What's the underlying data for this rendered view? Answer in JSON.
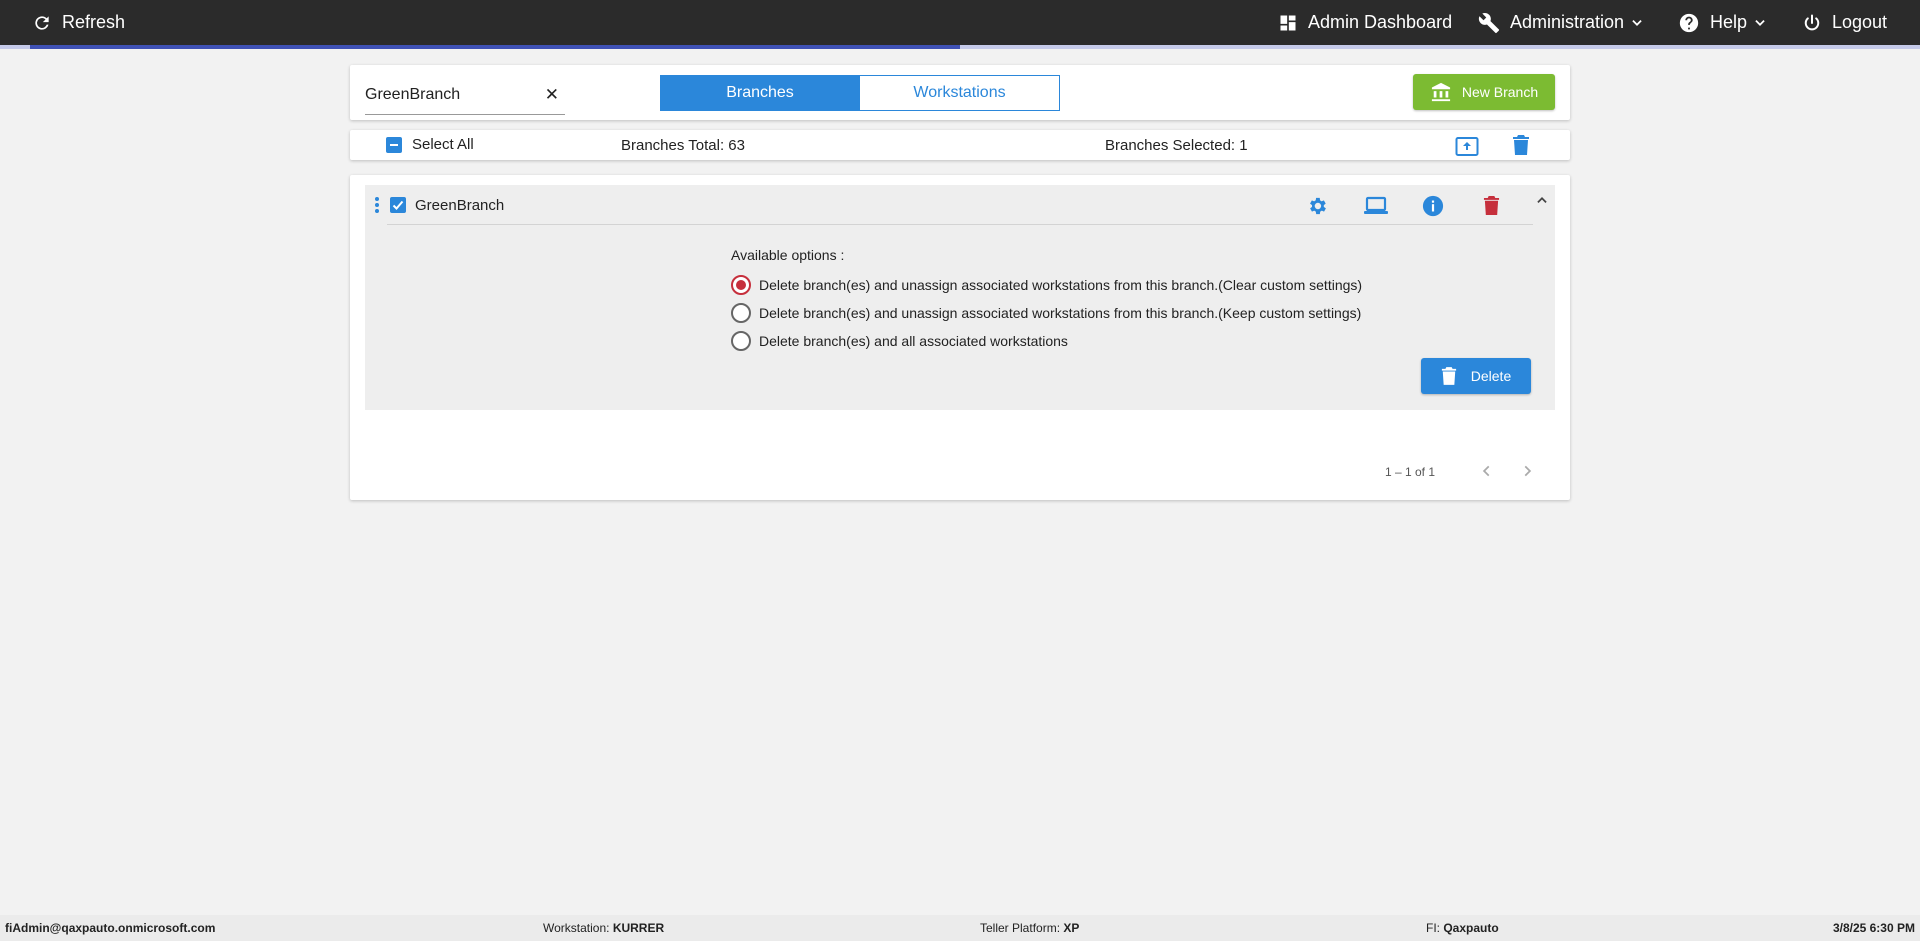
{
  "topbar": {
    "refresh_label": "Refresh",
    "admin_dashboard_label": "Admin Dashboard",
    "administration_label": "Administration",
    "help_label": "Help",
    "logout_label": "Logout",
    "load_progress": 0.5
  },
  "search": {
    "value": "GreenBranch"
  },
  "tabs": {
    "branches_label": "Branches",
    "workstations_label": "Workstations",
    "active": "Branches"
  },
  "new_branch_label": "New Branch",
  "summary": {
    "select_all_label": "Select All",
    "branches_total": "Branches Total: 63",
    "branches_selected": "Branches Selected: 1"
  },
  "branch": {
    "name": "GreenBranch",
    "checked": true
  },
  "delete_options": {
    "title": "Available options :",
    "items": [
      {
        "label": "Delete branch(es) and unassign associated workstations from this branch.(Clear custom settings)",
        "selected": true
      },
      {
        "label": "Delete branch(es) and unassign associated workstations from this branch.(Keep custom settings)",
        "selected": false
      },
      {
        "label": "Delete branch(es) and all associated workstations",
        "selected": false
      }
    ],
    "delete_label": "Delete"
  },
  "paginator": {
    "range_label": "1 – 1 of 1"
  },
  "footer": {
    "user": "fiAdmin@qaxpauto.onmicrosoft.com",
    "workstation_label": "Workstation:",
    "workstation_value": "KURRER",
    "teller_label": "Teller Platform:",
    "teller_value": "XP",
    "fi_label": "FI:",
    "fi_value": "Qaxpauto",
    "datetime": "3/8/25 6:30 PM"
  },
  "colors": {
    "accent": "#2b87da",
    "success": "#7cbb32",
    "danger": "#c62f3c",
    "topbar": "#2b2b2b",
    "progress": "#3f51b5"
  },
  "icons": [
    "refresh-icon",
    "dashboard-icon",
    "wrench-icon",
    "help-icon",
    "power-icon",
    "bank-icon",
    "upload-icon",
    "trash-icon",
    "gear-icon",
    "laptop-icon",
    "info-icon",
    "chevron-up-icon",
    "kebab-icon",
    "chevron-left-icon",
    "chevron-right-icon"
  ]
}
